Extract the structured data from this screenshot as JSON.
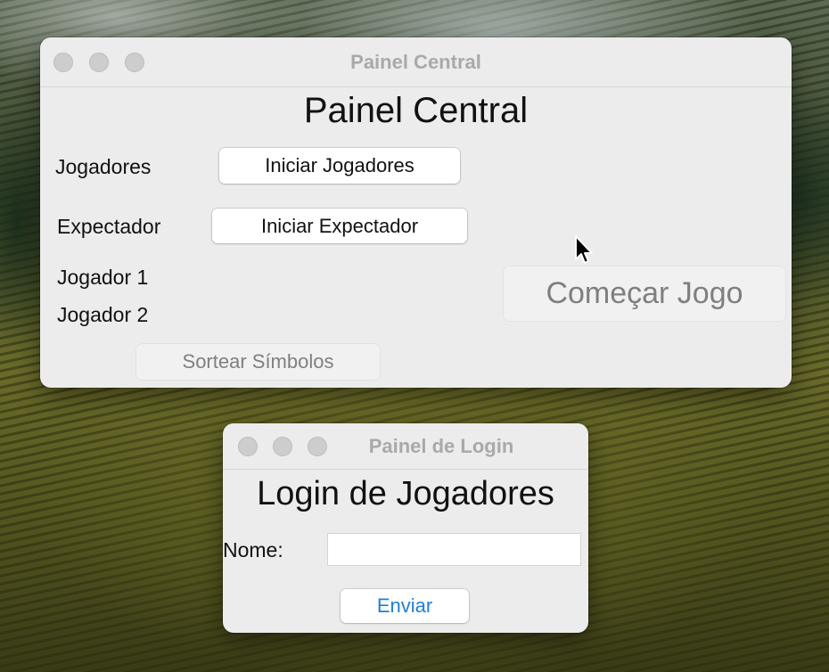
{
  "central": {
    "window_title": "Painel Central",
    "heading": "Painel Central",
    "jogadores_label": "Jogadores",
    "iniciar_jogadores": "Iniciar Jogadores",
    "expectador_label": "Expectador",
    "iniciar_expectador": "Iniciar Expectador",
    "jogador1": "Jogador 1",
    "jogador2": "Jogador 2",
    "comecar_jogo": "Começar Jogo",
    "sortear_simbolos": "Sortear Símbolos"
  },
  "login": {
    "window_title": "Painel de Login",
    "heading": "Login de Jogadores",
    "nome_label": "Nome:",
    "nome_value": "",
    "enviar": "Enviar"
  },
  "colors": {
    "window_bg": "#ececec",
    "title_text": "#a9a9a9",
    "disabled_text": "#7f7f7f",
    "link_blue": "#1f7fd2"
  },
  "icons": [
    "traffic-light-buttons",
    "mouse-pointer-cursor"
  ]
}
